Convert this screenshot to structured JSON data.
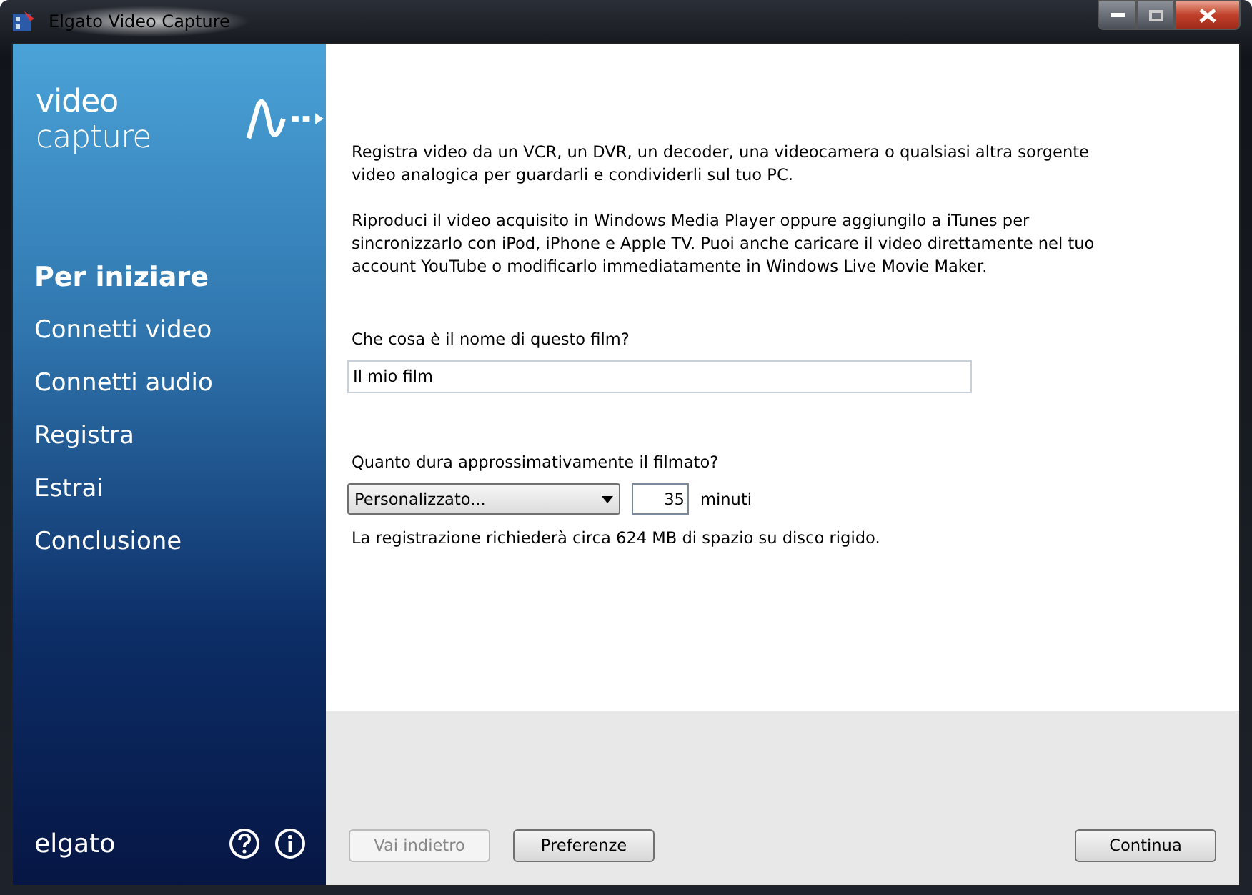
{
  "window": {
    "title": "Elgato Video Capture"
  },
  "sidebar": {
    "logo": "**video** capture",
    "items": [
      {
        "label": "Per iniziare",
        "selected": true
      },
      {
        "label": "Connetti video",
        "selected": false
      },
      {
        "label": "Connetti audio",
        "selected": false
      },
      {
        "label": "Registra",
        "selected": false
      },
      {
        "label": "Estrai",
        "selected": false
      },
      {
        "label": "Conclusione",
        "selected": false
      }
    ],
    "brand": "elgato"
  },
  "main": {
    "paragraphs": [
      "Registra video da un VCR, un DVR, un decoder, una videocamera o qualsiasi altra sorgente video analogica per  guardarli e condividerli sul tuo PC.",
      "Riproduci il video acquisito in Windows Media Player oppure aggiungilo a iTunes per sincronizzarlo con iPod, iPhone e Apple TV. Puoi anche caricare il video direttamente nel tuo account YouTube o modificarlo immediatamente in Windows Live Movie Maker."
    ],
    "name_label": "Che cosa è il nome di questo film?",
    "name_value": "Il mio film",
    "duration_label": "Quanto dura approssimativamente il filmato?",
    "duration_choice": "Personalizzato...",
    "minutes_value": "35",
    "minutes_unit": "minuti",
    "estimate": "La registrazione richiederà circa 624 MB di spazio su disco rigido."
  },
  "buttons": [
    {
      "label": "Vai indietro",
      "disabled": true
    },
    {
      "label": "Preferenze",
      "disabled": false
    },
    {
      "label": "Continua",
      "disabled": false
    }
  ]
}
